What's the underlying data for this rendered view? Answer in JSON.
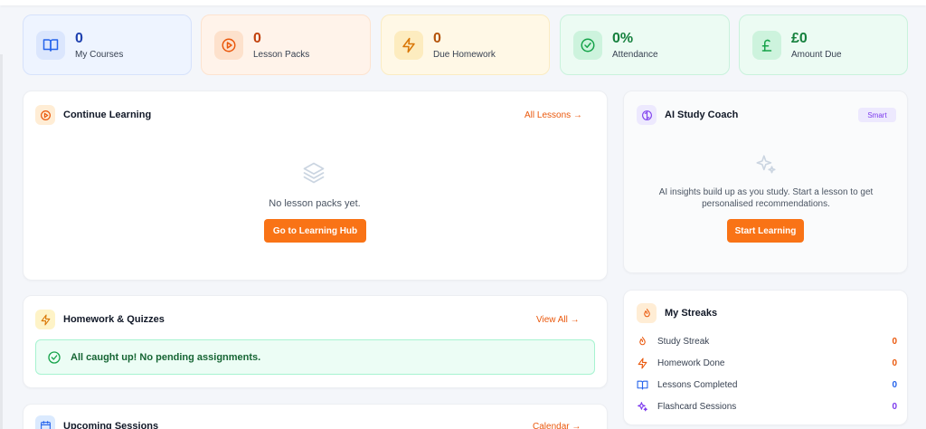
{
  "stats": [
    {
      "value": "0",
      "label": "My Courses",
      "icon": "book-open-icon",
      "bg": "#eef4ff",
      "border": "#d6e2fb",
      "iconBg": "#dbe6fd",
      "iconColor": "#2563eb",
      "valueColor": "#1e40af"
    },
    {
      "value": "0",
      "label": "Lesson Packs",
      "icon": "play-circle-icon",
      "bg": "#fff3ea",
      "border": "#fde3cf",
      "iconBg": "#fde1cc",
      "iconColor": "#ea580c",
      "valueColor": "#c2410c"
    },
    {
      "value": "0",
      "label": "Due Homework",
      "icon": "lightning-icon",
      "bg": "#fff8e6",
      "border": "#fbecc2",
      "iconBg": "#fdecbf",
      "iconColor": "#d97706",
      "valueColor": "#b45309"
    },
    {
      "value": "0%",
      "label": "Attendance",
      "icon": "check-circle-icon",
      "bg": "#ecfbf3",
      "border": "#c9f2dc",
      "iconBg": "#cdf3dd",
      "iconColor": "#16a34a",
      "valueColor": "#15803d"
    },
    {
      "value": "£0",
      "label": "Amount Due",
      "icon": "pound-icon",
      "bg": "#ecfbf3",
      "border": "#c9f2dc",
      "iconBg": "#cdf3dd",
      "iconColor": "#16a34a",
      "valueColor": "#15803d"
    }
  ],
  "continue_learning": {
    "title": "Continue Learning",
    "link": "All Lessons →",
    "empty_text": "No lesson packs yet.",
    "button": "Go to Learning Hub"
  },
  "ai_coach": {
    "title": "AI Study Coach",
    "badge": "Smart",
    "text_line1": "AI insights build up as you study. Start a lesson to get",
    "text_line2": "personalised recommendations.",
    "button": "Start Learning"
  },
  "homework": {
    "title": "Homework & Quizzes",
    "link": "View All →",
    "status": "All caught up! No pending assignments."
  },
  "streaks": {
    "title": "My Streaks",
    "items": [
      {
        "label": "Study Streak",
        "value": "0",
        "icon": "flame-icon",
        "color": "#ea580c"
      },
      {
        "label": "Homework Done",
        "value": "0",
        "icon": "lightning-icon",
        "color": "#ea580c"
      },
      {
        "label": "Lessons Completed",
        "value": "0",
        "icon": "book-open-icon",
        "color": "#2563eb"
      },
      {
        "label": "Flashcard Sessions",
        "value": "0",
        "icon": "sparkle-icon",
        "color": "#7c3aed"
      }
    ]
  },
  "sessions": {
    "title": "Upcoming Sessions",
    "link": "Calendar →"
  },
  "colors": {
    "accent": "#f97316",
    "link": "#ea580c"
  }
}
